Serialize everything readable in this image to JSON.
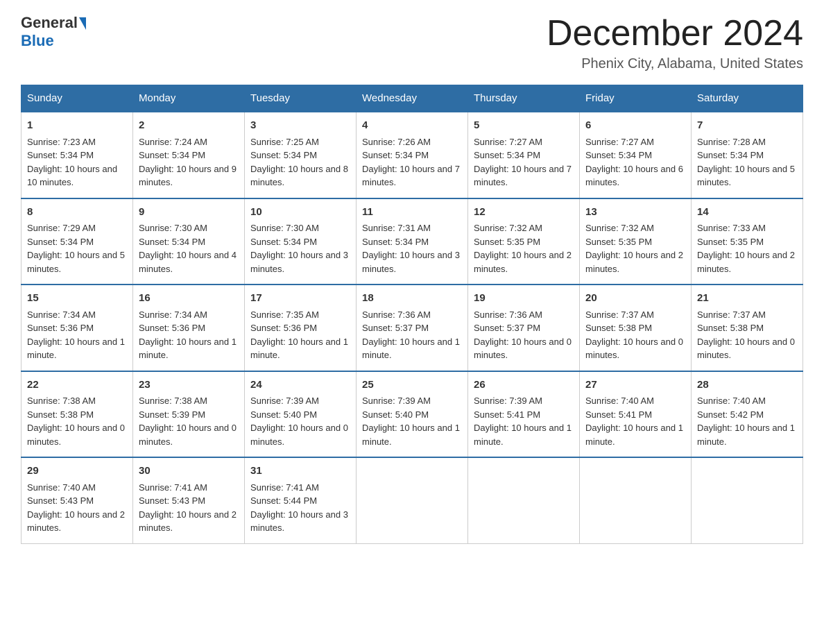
{
  "logo": {
    "general": "General",
    "blue": "Blue"
  },
  "header": {
    "month": "December 2024",
    "location": "Phenix City, Alabama, United States"
  },
  "days": [
    "Sunday",
    "Monday",
    "Tuesday",
    "Wednesday",
    "Thursday",
    "Friday",
    "Saturday"
  ],
  "weeks": [
    [
      {
        "day": "1",
        "sunrise": "7:23 AM",
        "sunset": "5:34 PM",
        "daylight": "10 hours and 10 minutes."
      },
      {
        "day": "2",
        "sunrise": "7:24 AM",
        "sunset": "5:34 PM",
        "daylight": "10 hours and 9 minutes."
      },
      {
        "day": "3",
        "sunrise": "7:25 AM",
        "sunset": "5:34 PM",
        "daylight": "10 hours and 8 minutes."
      },
      {
        "day": "4",
        "sunrise": "7:26 AM",
        "sunset": "5:34 PM",
        "daylight": "10 hours and 7 minutes."
      },
      {
        "day": "5",
        "sunrise": "7:27 AM",
        "sunset": "5:34 PM",
        "daylight": "10 hours and 7 minutes."
      },
      {
        "day": "6",
        "sunrise": "7:27 AM",
        "sunset": "5:34 PM",
        "daylight": "10 hours and 6 minutes."
      },
      {
        "day": "7",
        "sunrise": "7:28 AM",
        "sunset": "5:34 PM",
        "daylight": "10 hours and 5 minutes."
      }
    ],
    [
      {
        "day": "8",
        "sunrise": "7:29 AM",
        "sunset": "5:34 PM",
        "daylight": "10 hours and 5 minutes."
      },
      {
        "day": "9",
        "sunrise": "7:30 AM",
        "sunset": "5:34 PM",
        "daylight": "10 hours and 4 minutes."
      },
      {
        "day": "10",
        "sunrise": "7:30 AM",
        "sunset": "5:34 PM",
        "daylight": "10 hours and 3 minutes."
      },
      {
        "day": "11",
        "sunrise": "7:31 AM",
        "sunset": "5:34 PM",
        "daylight": "10 hours and 3 minutes."
      },
      {
        "day": "12",
        "sunrise": "7:32 AM",
        "sunset": "5:35 PM",
        "daylight": "10 hours and 2 minutes."
      },
      {
        "day": "13",
        "sunrise": "7:32 AM",
        "sunset": "5:35 PM",
        "daylight": "10 hours and 2 minutes."
      },
      {
        "day": "14",
        "sunrise": "7:33 AM",
        "sunset": "5:35 PM",
        "daylight": "10 hours and 2 minutes."
      }
    ],
    [
      {
        "day": "15",
        "sunrise": "7:34 AM",
        "sunset": "5:36 PM",
        "daylight": "10 hours and 1 minute."
      },
      {
        "day": "16",
        "sunrise": "7:34 AM",
        "sunset": "5:36 PM",
        "daylight": "10 hours and 1 minute."
      },
      {
        "day": "17",
        "sunrise": "7:35 AM",
        "sunset": "5:36 PM",
        "daylight": "10 hours and 1 minute."
      },
      {
        "day": "18",
        "sunrise": "7:36 AM",
        "sunset": "5:37 PM",
        "daylight": "10 hours and 1 minute."
      },
      {
        "day": "19",
        "sunrise": "7:36 AM",
        "sunset": "5:37 PM",
        "daylight": "10 hours and 0 minutes."
      },
      {
        "day": "20",
        "sunrise": "7:37 AM",
        "sunset": "5:38 PM",
        "daylight": "10 hours and 0 minutes."
      },
      {
        "day": "21",
        "sunrise": "7:37 AM",
        "sunset": "5:38 PM",
        "daylight": "10 hours and 0 minutes."
      }
    ],
    [
      {
        "day": "22",
        "sunrise": "7:38 AM",
        "sunset": "5:38 PM",
        "daylight": "10 hours and 0 minutes."
      },
      {
        "day": "23",
        "sunrise": "7:38 AM",
        "sunset": "5:39 PM",
        "daylight": "10 hours and 0 minutes."
      },
      {
        "day": "24",
        "sunrise": "7:39 AM",
        "sunset": "5:40 PM",
        "daylight": "10 hours and 0 minutes."
      },
      {
        "day": "25",
        "sunrise": "7:39 AM",
        "sunset": "5:40 PM",
        "daylight": "10 hours and 1 minute."
      },
      {
        "day": "26",
        "sunrise": "7:39 AM",
        "sunset": "5:41 PM",
        "daylight": "10 hours and 1 minute."
      },
      {
        "day": "27",
        "sunrise": "7:40 AM",
        "sunset": "5:41 PM",
        "daylight": "10 hours and 1 minute."
      },
      {
        "day": "28",
        "sunrise": "7:40 AM",
        "sunset": "5:42 PM",
        "daylight": "10 hours and 1 minute."
      }
    ],
    [
      {
        "day": "29",
        "sunrise": "7:40 AM",
        "sunset": "5:43 PM",
        "daylight": "10 hours and 2 minutes."
      },
      {
        "day": "30",
        "sunrise": "7:41 AM",
        "sunset": "5:43 PM",
        "daylight": "10 hours and 2 minutes."
      },
      {
        "day": "31",
        "sunrise": "7:41 AM",
        "sunset": "5:44 PM",
        "daylight": "10 hours and 3 minutes."
      },
      null,
      null,
      null,
      null
    ]
  ]
}
